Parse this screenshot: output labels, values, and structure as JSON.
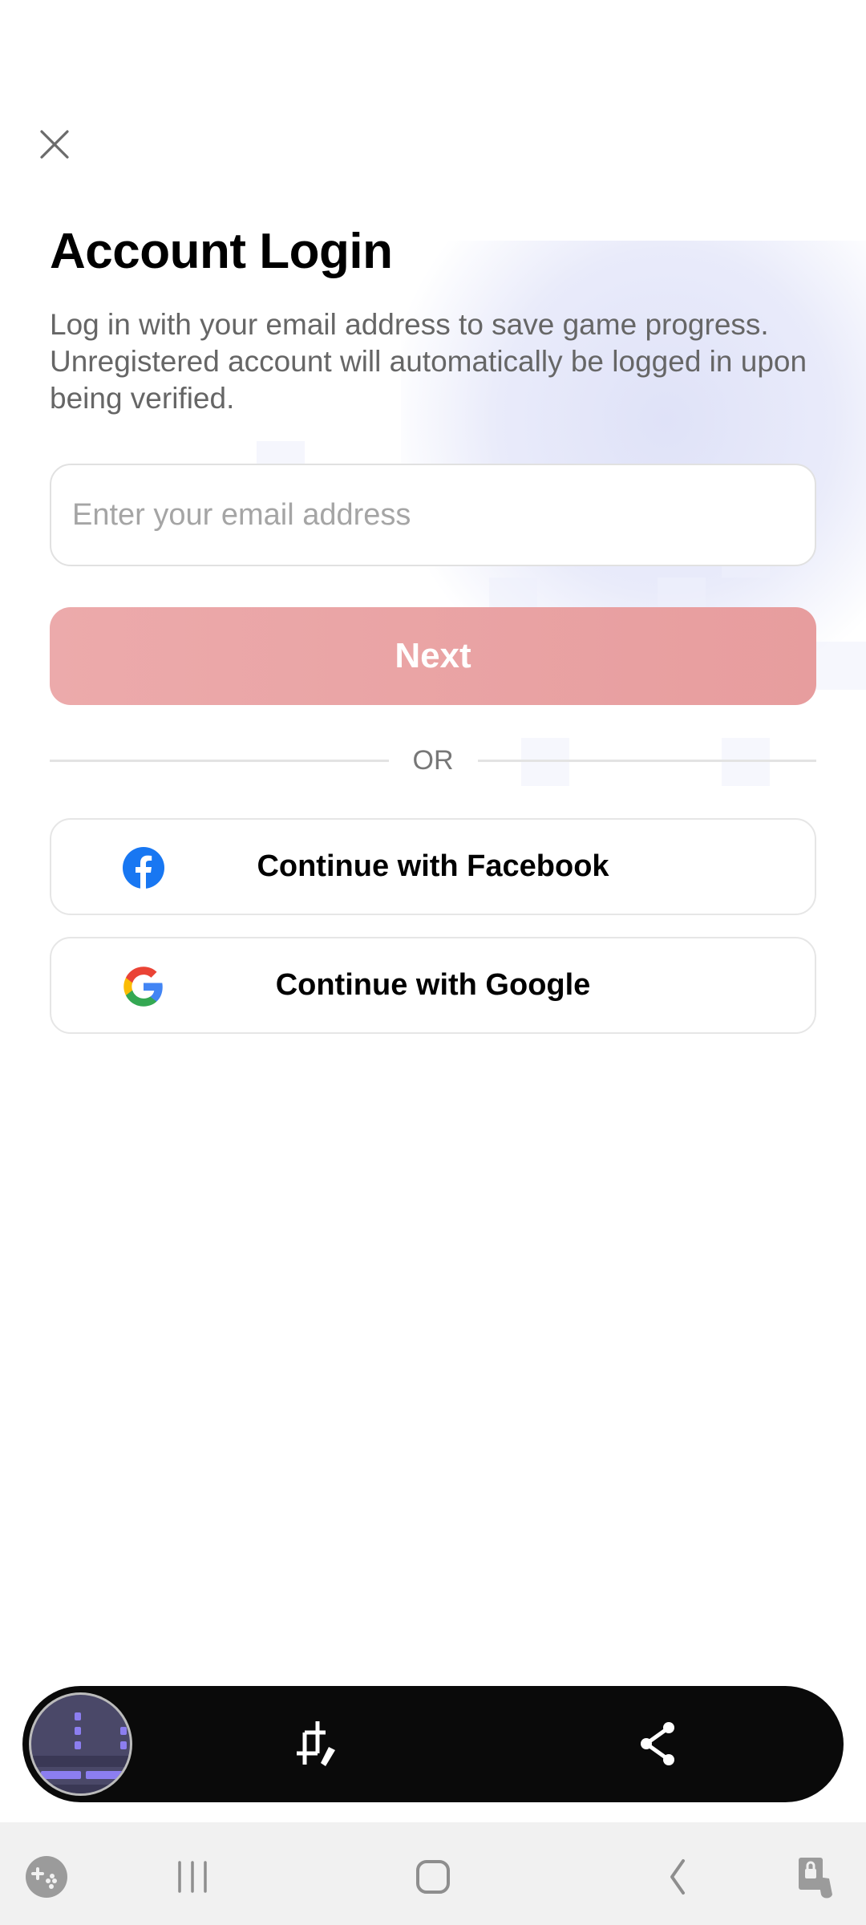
{
  "login": {
    "title": "Account Login",
    "description": "Log in with your email address to save game progress. Unregistered account will automatically be logged in upon being verified.",
    "email_placeholder": "Enter your email address",
    "email_value": "",
    "next_label": "Next",
    "divider_label": "OR",
    "facebook_label": "Continue with Facebook",
    "google_label": "Continue with Google"
  },
  "colors": {
    "next_button": "#e9a3a4",
    "facebook_blue": "#1877f2",
    "google_red": "#ea4335",
    "google_yellow": "#fbbc05",
    "google_green": "#34a853",
    "google_blue": "#4285f4"
  },
  "screenshot_toolbar": {
    "thumbnail": "screenshot-preview",
    "actions": [
      "crop-edit-icon",
      "share-icon"
    ]
  },
  "navbar": {
    "icons": [
      "game-launcher-icon",
      "recents-icon",
      "home-icon",
      "back-icon",
      "accessibility-icon"
    ]
  }
}
